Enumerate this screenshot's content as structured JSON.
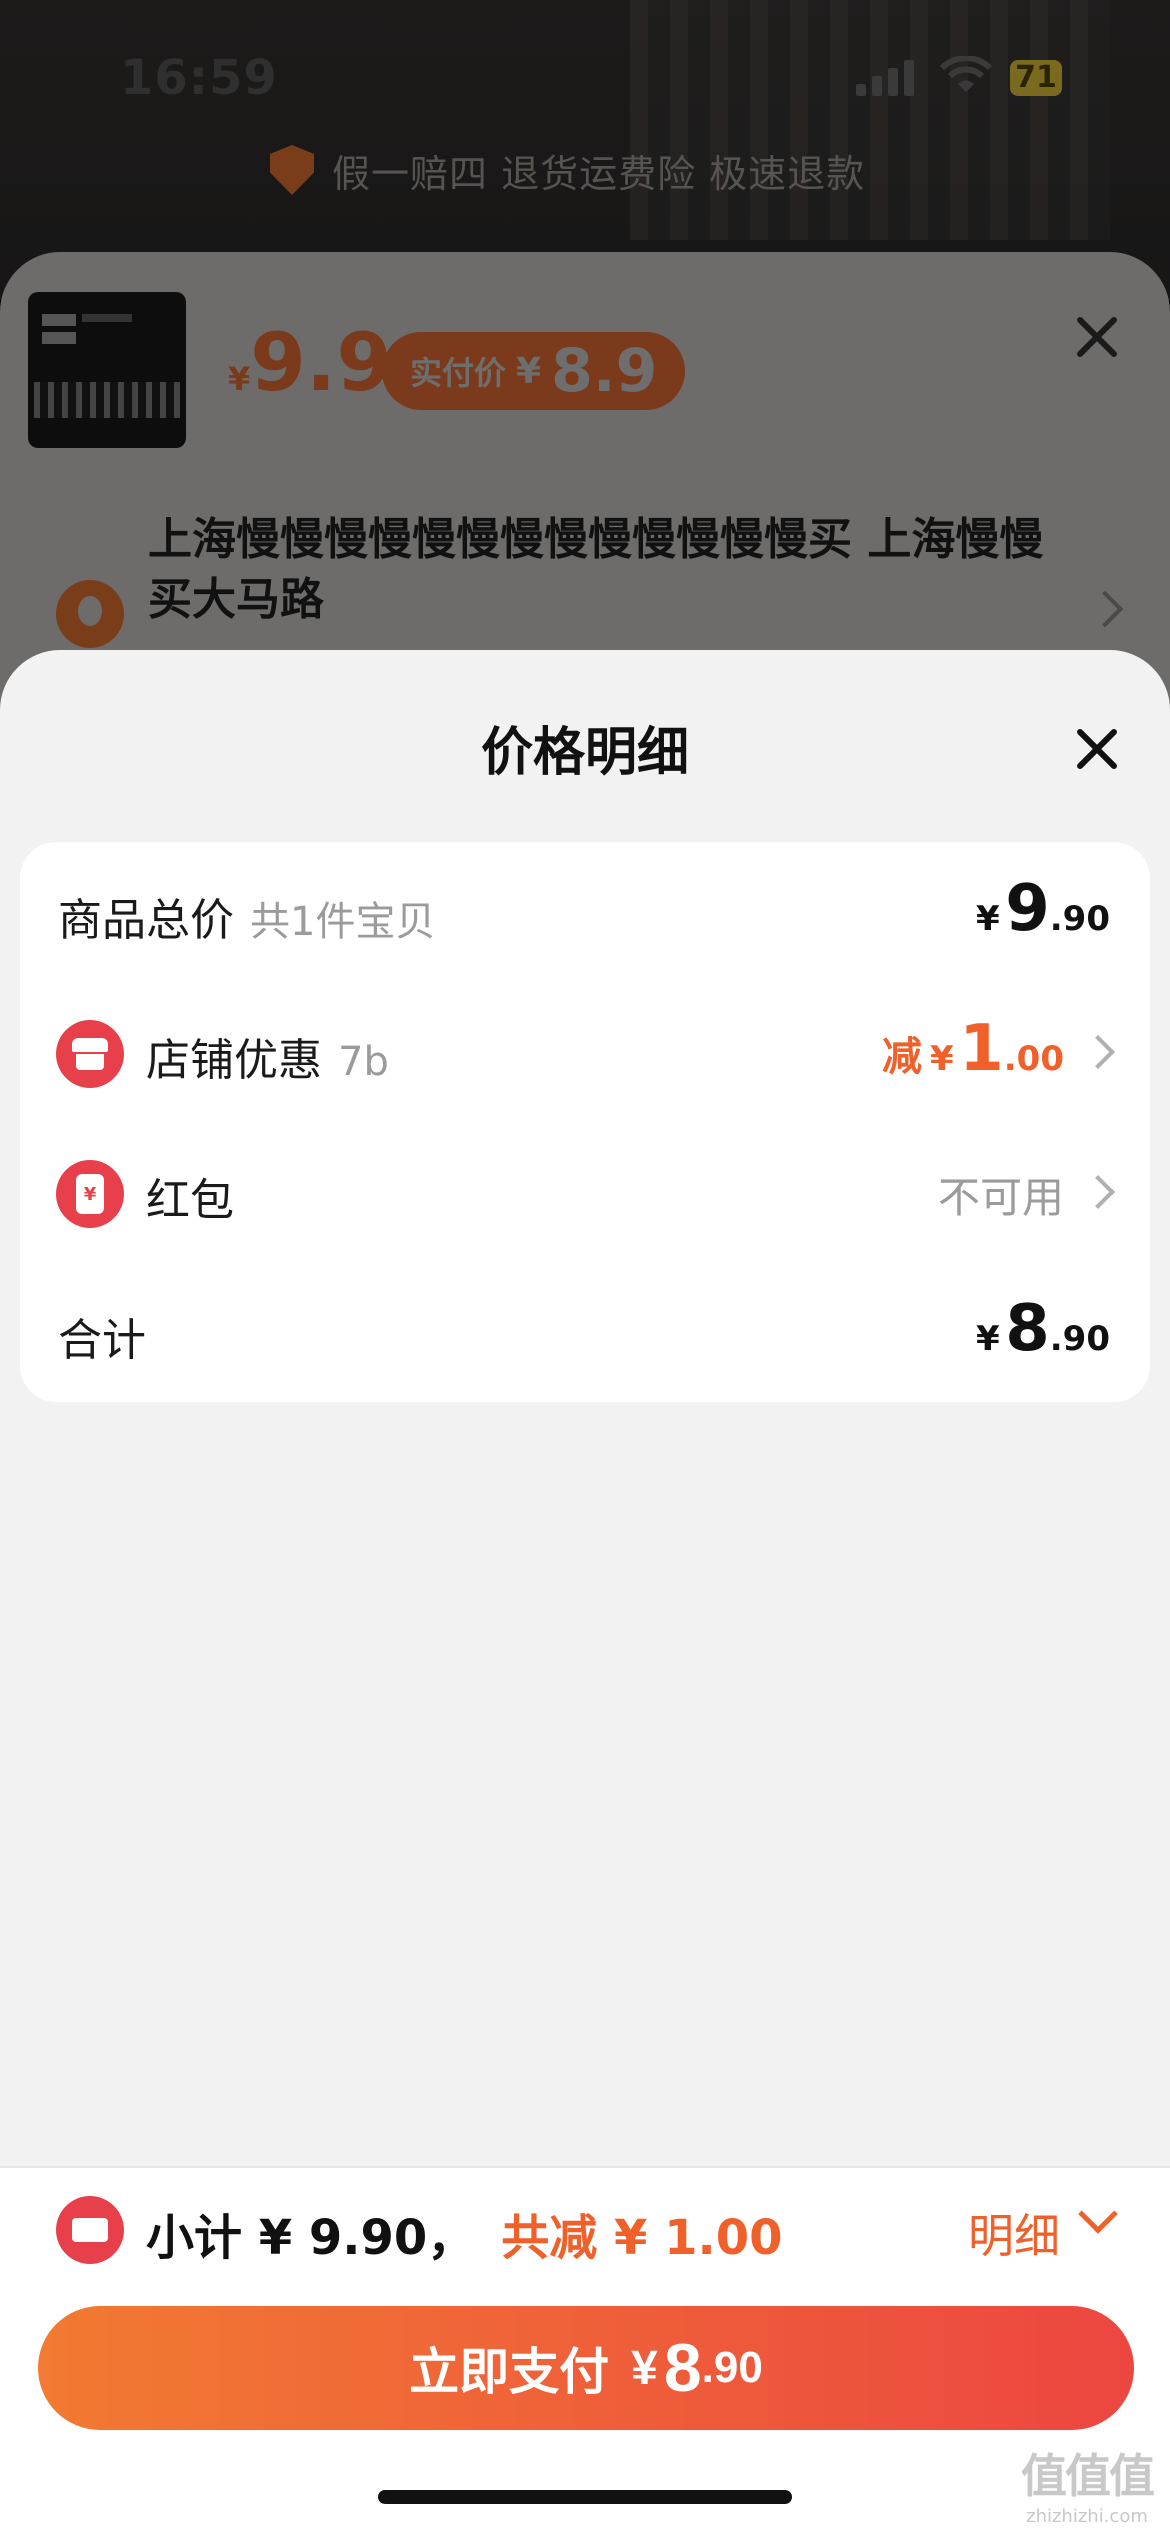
{
  "status_bar": {
    "time": "16:59",
    "battery": "71"
  },
  "background": {
    "guarantee_text": "假一赔四 退货运费险 极速退款",
    "price": {
      "currency": "¥",
      "value": "9.9"
    },
    "paid_price": {
      "label": "实付价",
      "currency": "¥",
      "value": "8.9"
    },
    "address": "上海慢慢慢慢慢慢慢慢慢慢慢慢慢买 上海慢慢买大马路"
  },
  "price_detail": {
    "title": "价格明细",
    "rows": {
      "goods_total": {
        "label": "商品总价",
        "sub": "共1件宝贝",
        "currency": "¥",
        "int": "9",
        "dec": ".90"
      },
      "store_discount": {
        "label": "店铺优惠",
        "sub": "7b",
        "lead": "减",
        "currency": "¥",
        "int": "1",
        "dec": ".00"
      },
      "red_packet": {
        "label": "红包",
        "status": "不可用",
        "icon_char": "¥"
      },
      "total": {
        "label": "合计",
        "currency": "¥",
        "int": "8",
        "dec": ".90"
      }
    }
  },
  "bottom": {
    "subtotal": "小计 ¥ 9.90，",
    "discount": "共减 ¥ 1.00",
    "detail_label": "明细",
    "pay_label": "立即支付",
    "pay_currency": "¥",
    "pay_int": "8",
    "pay_dec": ".90"
  },
  "watermark": {
    "glyphs": "值值值",
    "domain": "zhizhizhi.com"
  },
  "colors": {
    "accent": "#f0602b",
    "red": "#e8404a",
    "gradient_start": "#f27a32",
    "gradient_end": "#ec4640"
  },
  "icons": [
    "shield-icon",
    "close-icon",
    "location-pin-icon",
    "chevron-right-icon",
    "store-icon",
    "red-packet-icon",
    "ticket-icon",
    "chevron-down-icon"
  ]
}
